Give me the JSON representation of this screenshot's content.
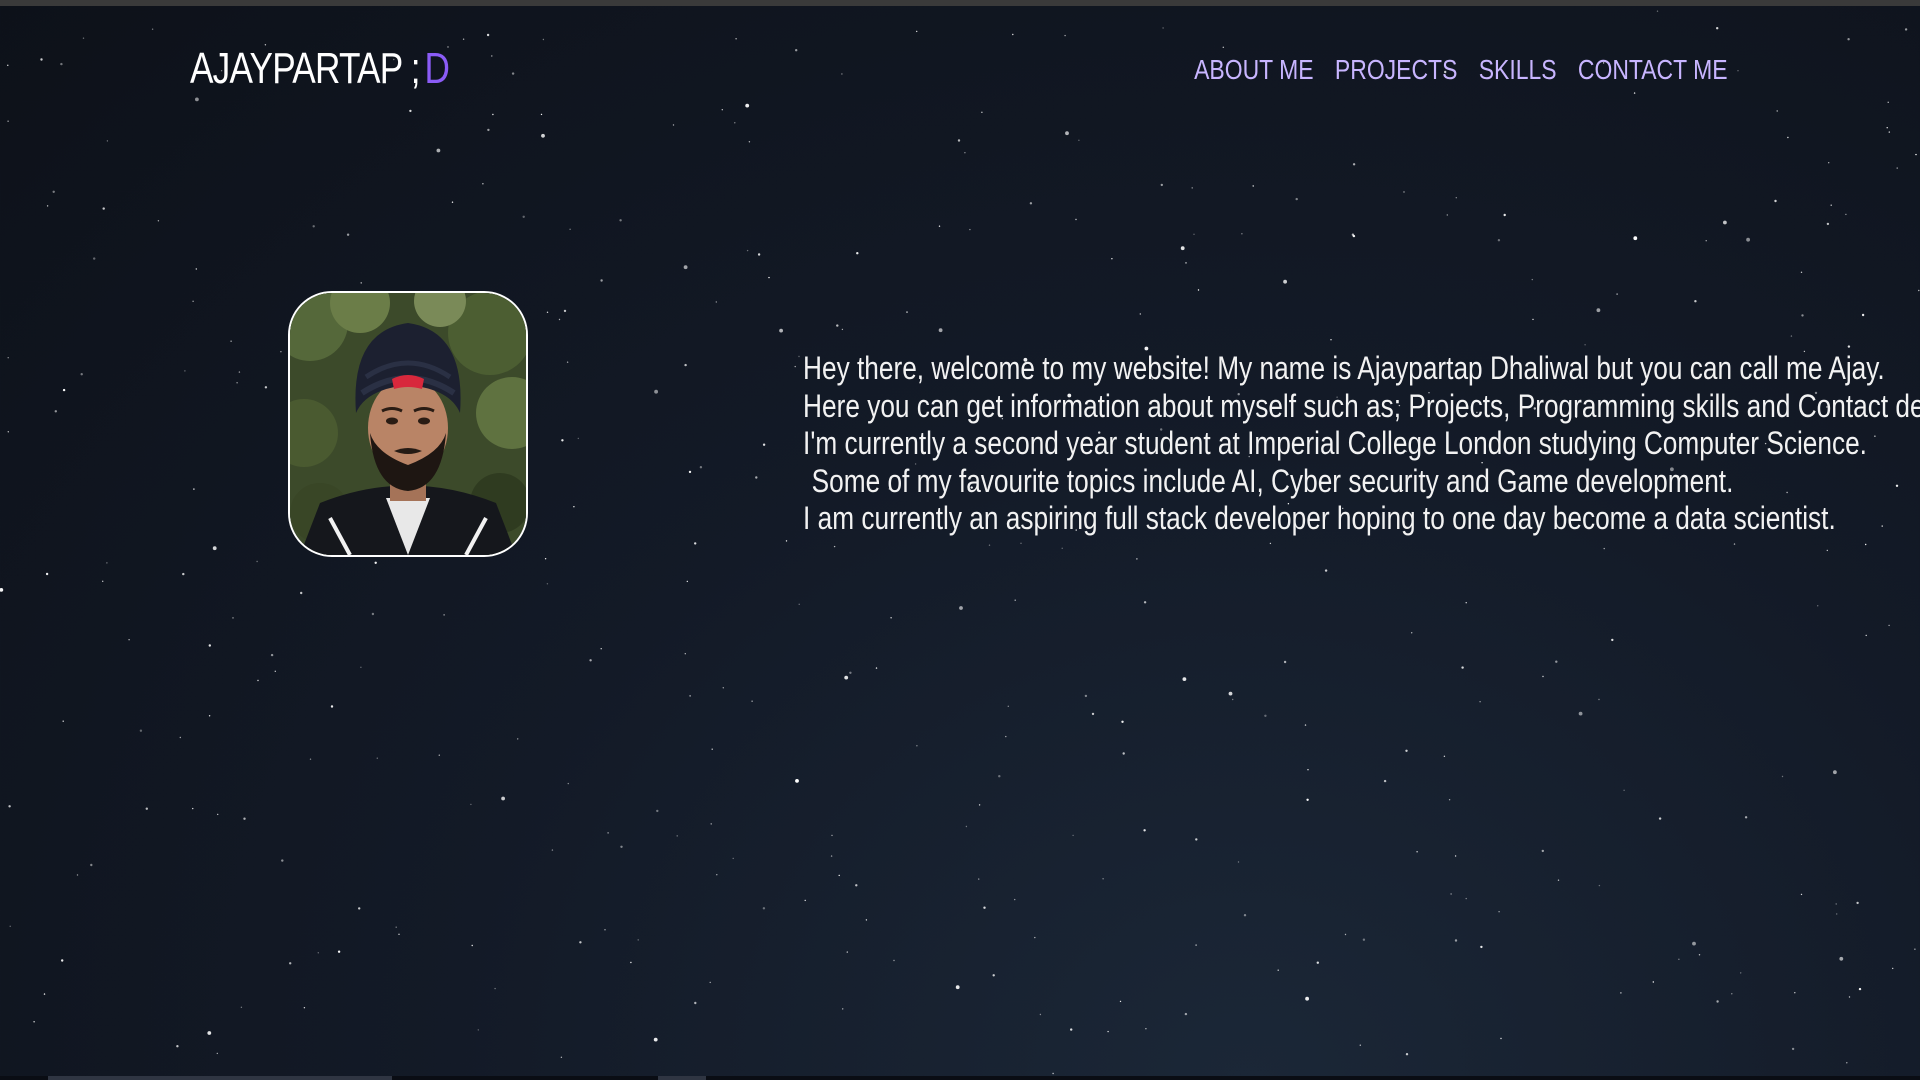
{
  "header": {
    "logo_text": "AJAYPARTAP ;",
    "logo_accent": "D",
    "nav": [
      {
        "label": "ABOUT ME"
      },
      {
        "label": "PROJECTS"
      },
      {
        "label": "SKILLS"
      },
      {
        "label": "CONTACT ME"
      }
    ]
  },
  "intro": {
    "lines": [
      "Hey there, welcome to my website! My name is Ajaypartap Dhaliwal but you can call me Ajay.",
      "Here you can get information about myself such as; Projects, Programming skills and Contact detail.",
      "I'm currently a second year student at Imperial College London studying Computer Science.",
      "Some of my favourite topics include AI, Cyber security and Game development.",
      "I am currently an aspiring full stack developer hoping to one day become a data scientist."
    ]
  },
  "colors": {
    "background": "#131a27",
    "nav_link": "#c8b5ff",
    "logo_accent": "#8b5cf6",
    "text": "#f2f2f2"
  }
}
